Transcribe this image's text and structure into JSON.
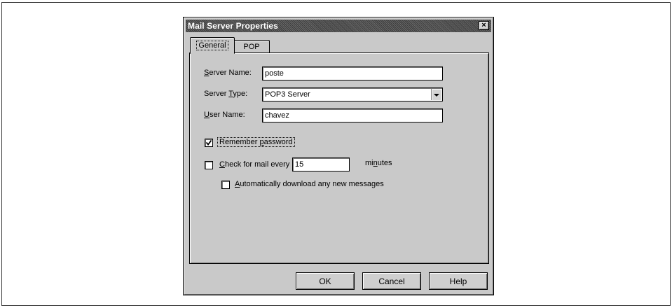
{
  "dialog": {
    "title": "Mail Server Properties",
    "close_glyph": "×"
  },
  "tabs": [
    {
      "label": "General",
      "active": true
    },
    {
      "label": "POP",
      "active": false
    }
  ],
  "form": {
    "server_name": {
      "label_key": "S",
      "label_rest": "erver Name:",
      "value": "poste"
    },
    "server_type": {
      "label_pre": "Server ",
      "label_key": "T",
      "label_rest": "ype:",
      "value": "POP3 Server"
    },
    "user_name": {
      "label_key": "U",
      "label_rest": "ser Name:",
      "value": "chavez"
    },
    "remember_password": {
      "label_pre": "Remember ",
      "label_key": "p",
      "label_rest": "assword",
      "checked": true
    },
    "check_mail": {
      "label_key": "C",
      "label_rest": "heck for mail every",
      "checked": false,
      "interval": "15",
      "units_pre": "mi",
      "units_key": "n",
      "units_rest": "utes"
    },
    "auto_download": {
      "label_key": "A",
      "label_rest": "utomatically download any new messages",
      "checked": false
    }
  },
  "buttons": {
    "ok": "OK",
    "cancel": "Cancel",
    "help": "Help"
  },
  "icons": {
    "close": "close-icon",
    "dropdown": "chevron-down-icon",
    "check": "checkmark-icon"
  },
  "colors": {
    "face": "#c9c9c9",
    "titlebar": "#4f4f4f",
    "field": "#ffffff"
  }
}
